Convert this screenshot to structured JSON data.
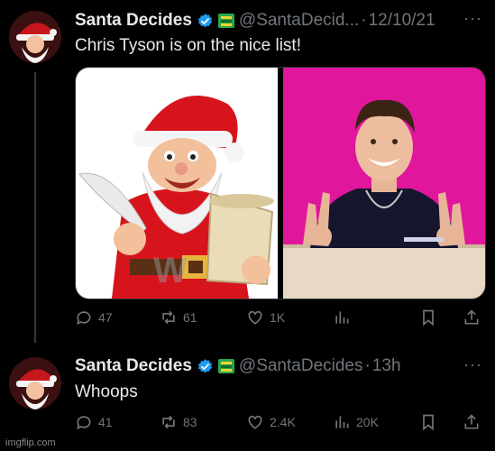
{
  "tweet1": {
    "name": "Santa Decides",
    "handle": "@SantaDecid...",
    "separator": "·",
    "time": "12/10/21",
    "text": "Chris Tyson is on the nice list!",
    "replies": "47",
    "retweets": "61",
    "likes": "1K",
    "views": "",
    "more": "···"
  },
  "tweet2": {
    "name": "Santa Decides",
    "handle": "@SantaDecides",
    "separator": "·",
    "time": "13h",
    "text": "Whoops",
    "replies": "41",
    "retweets": "83",
    "likes": "2.4K",
    "views": "20K",
    "more": "···"
  },
  "watermark": "imgflip.com",
  "colors": {
    "background": "#000000",
    "text": "#e7e9ea",
    "muted": "#71767b",
    "verified": "#1d9bf0",
    "pink": "#e0169c"
  }
}
